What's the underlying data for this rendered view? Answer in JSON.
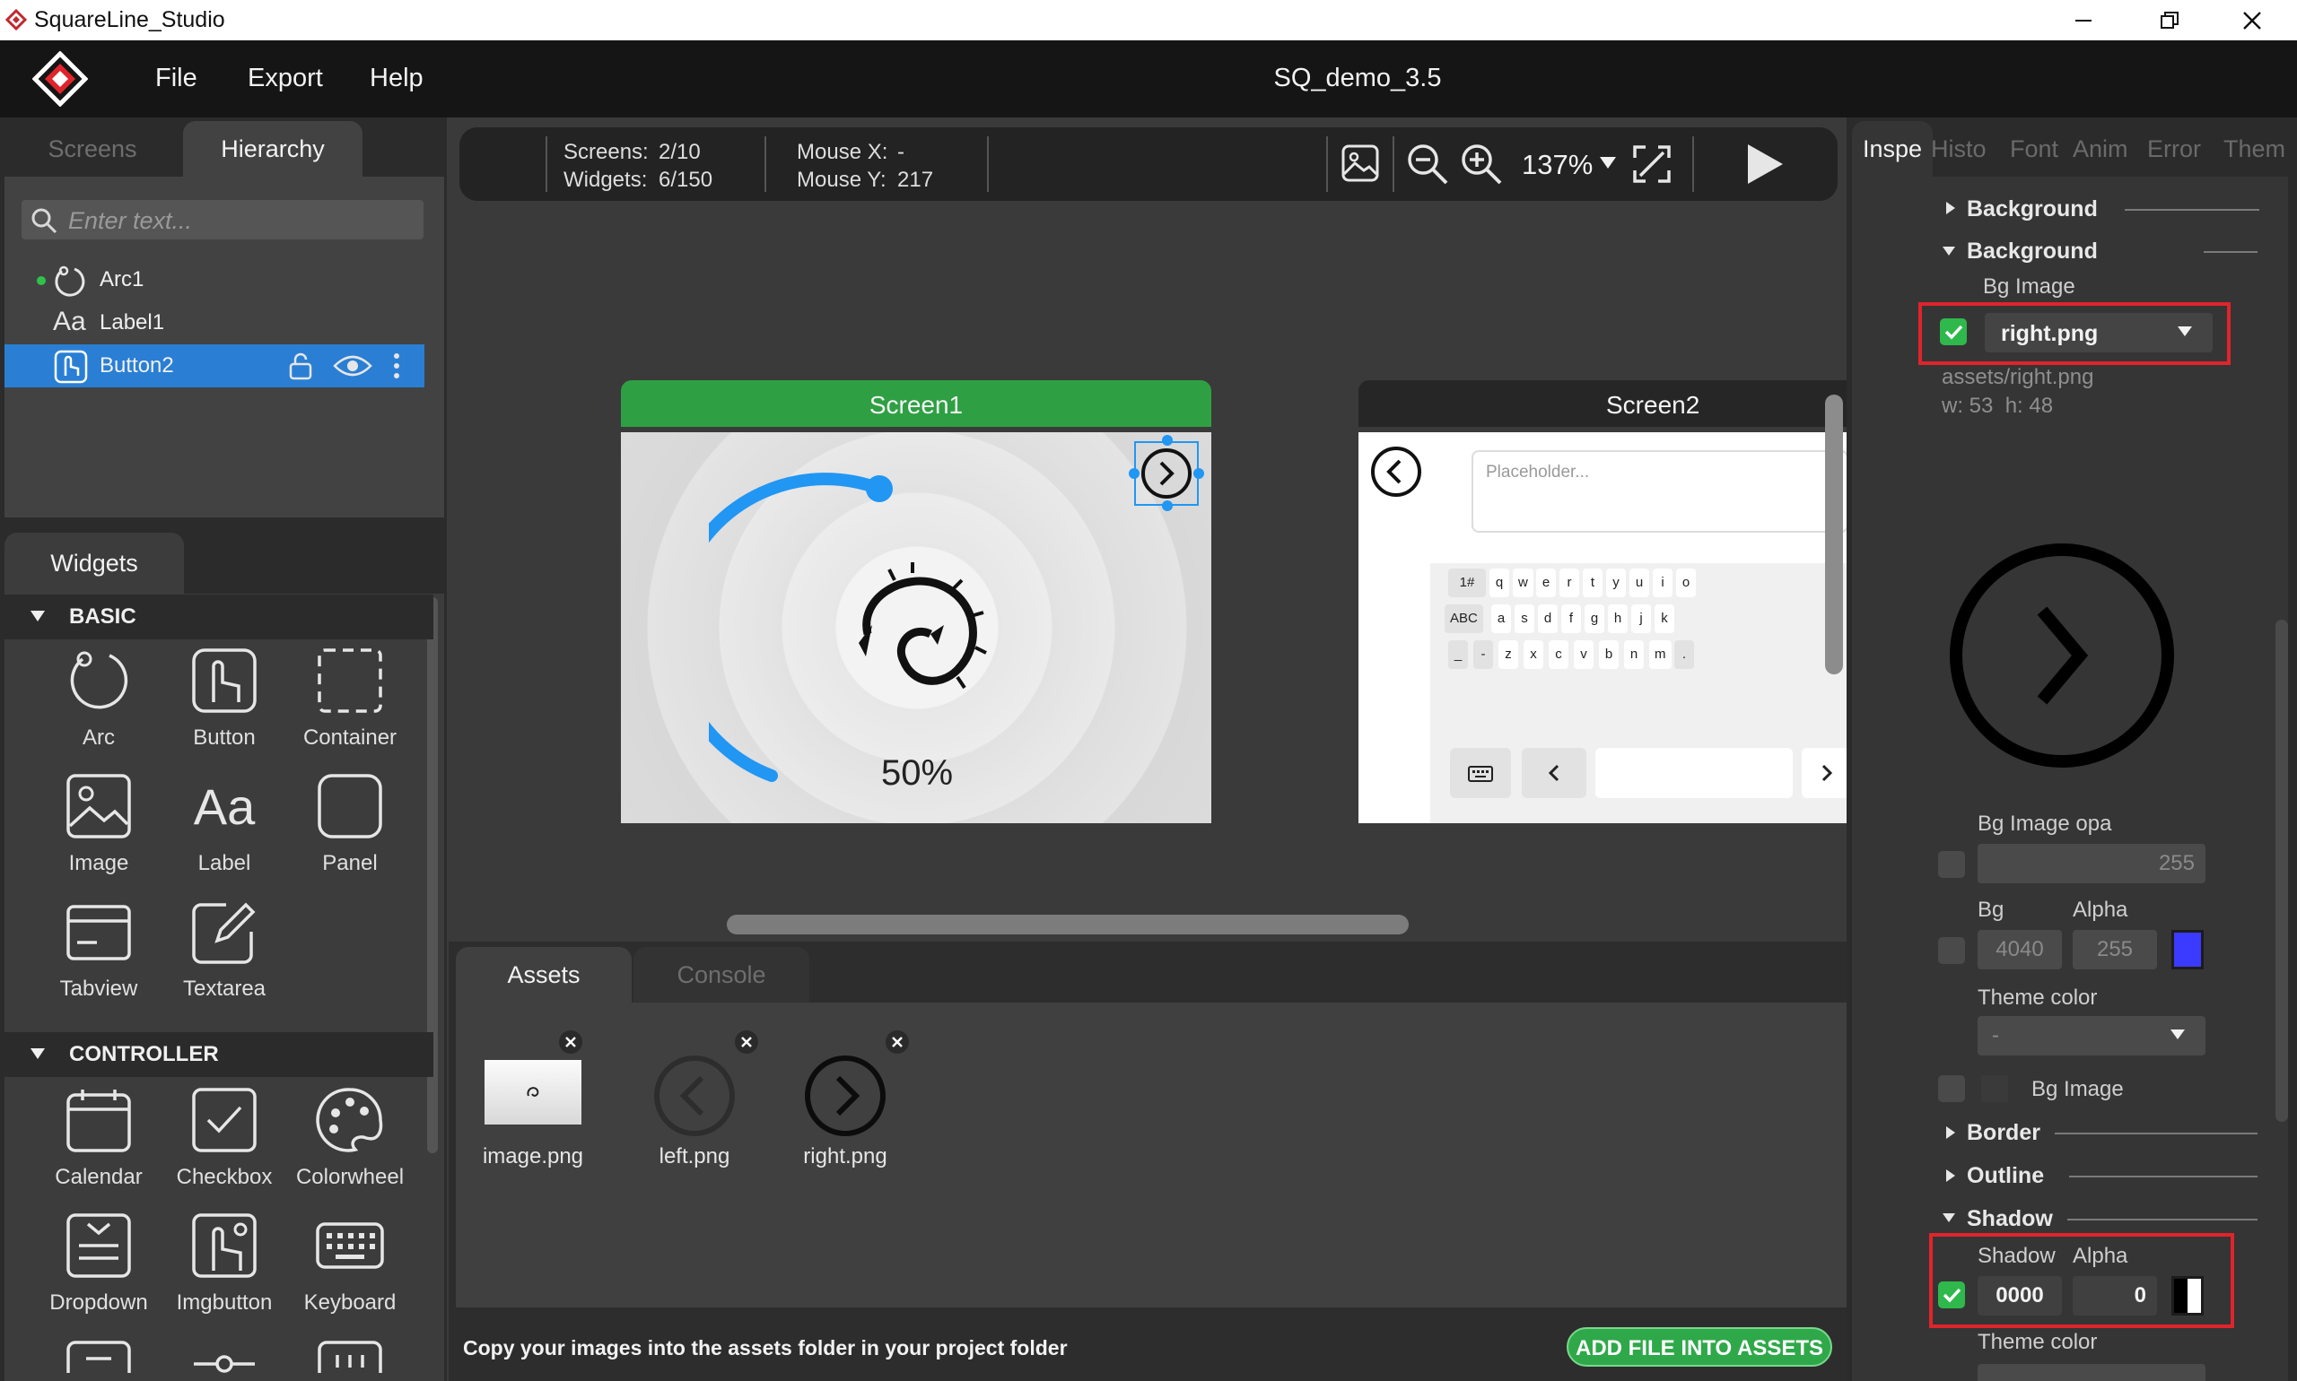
{
  "app": {
    "window_title": "SquareLine_Studio",
    "project_name": "SQ_demo_3.5",
    "menu": [
      "File",
      "Export",
      "Help"
    ]
  },
  "left": {
    "tabs": [
      "Screens",
      "Hierarchy"
    ],
    "search_placeholder": "Enter text...",
    "tree": [
      {
        "label": "Arc1",
        "icon": "arc-icon"
      },
      {
        "label": "Label1",
        "icon": "label-icon"
      },
      {
        "label": "Button2",
        "icon": "button-icon",
        "selected": true
      }
    ],
    "widgets_tab": "Widgets",
    "sections": [
      {
        "title": "BASIC",
        "items": [
          {
            "label": "Arc",
            "icon": "arc-icon"
          },
          {
            "label": "Button",
            "icon": "button-icon"
          },
          {
            "label": "Container",
            "icon": "container-icon"
          },
          {
            "label": "Image",
            "icon": "image-icon"
          },
          {
            "label": "Label",
            "icon": "label-icon"
          },
          {
            "label": "Panel",
            "icon": "panel-icon"
          },
          {
            "label": "Tabview",
            "icon": "tabview-icon"
          },
          {
            "label": "Textarea",
            "icon": "textarea-icon"
          }
        ]
      },
      {
        "title": "CONTROLLER",
        "items": [
          {
            "label": "Calendar",
            "icon": "calendar-icon"
          },
          {
            "label": "Checkbox",
            "icon": "checkbox-icon"
          },
          {
            "label": "Colorwheel",
            "icon": "colorwheel-icon"
          },
          {
            "label": "Dropdown",
            "icon": "dropdown-icon"
          },
          {
            "label": "Imgbutton",
            "icon": "imgbutton-icon"
          },
          {
            "label": "Keyboard",
            "icon": "keyboard-icon"
          }
        ]
      }
    ]
  },
  "toolbar": {
    "screens_label": "Screens:",
    "screens_value": "2/10",
    "widgets_label": "Widgets:",
    "widgets_value": "6/150",
    "mouse_x_label": "Mouse X:",
    "mouse_x_value": "-",
    "mouse_y_label": "Mouse Y:",
    "mouse_y_value": "217",
    "zoom": "137%"
  },
  "canvas": {
    "screen1": {
      "title": "Screen1",
      "arc_value_text": "50%",
      "arc_percent": 50,
      "title_color": "#2ea043"
    },
    "screen2": {
      "title": "Screen2",
      "textarea_placeholder": "Placeholder...",
      "keyboard_rows": [
        [
          "1#",
          "q",
          "w",
          "e",
          "r",
          "t",
          "y",
          "u",
          "i",
          "o"
        ],
        [
          "ABC",
          "a",
          "s",
          "d",
          "f",
          "g",
          "h",
          "j",
          "k"
        ],
        [
          "_",
          "-",
          "z",
          "x",
          "c",
          "v",
          "b",
          "n",
          "m",
          "."
        ]
      ]
    }
  },
  "bottom": {
    "tabs": [
      "Assets",
      "Console"
    ],
    "assets": [
      {
        "name": "image.png"
      },
      {
        "name": "left.png"
      },
      {
        "name": "right.png"
      }
    ],
    "hint": "Copy your images into the assets folder in your project folder",
    "add_button": "ADD FILE INTO ASSETS"
  },
  "inspector": {
    "tabs": [
      "Inspe",
      "Histo",
      "Font",
      "Anim",
      "Error",
      "Them"
    ],
    "background_collapsed": "Background",
    "background_expanded": "Background",
    "bg_image_label": "Bg Image",
    "bg_image_value": "right.png",
    "bg_image_path": "assets/right.png",
    "bg_image_size": "w: 53  h: 48",
    "bg_image_opa_label": "Bg Image opa",
    "bg_image_opa_value": "255",
    "bg_label": "Bg",
    "alpha_label": "Alpha",
    "bg_color_value": "4040",
    "bg_alpha_value": "255",
    "bg_swatch_color": "#3b3bff",
    "theme_color_label": "Theme color",
    "theme_color_value": "-",
    "bg_image_label2": "Bg Image",
    "border": "Border",
    "outline": "Outline",
    "shadow": "Shadow",
    "shadow_label": "Shadow",
    "shadow_alpha_label": "Alpha",
    "shadow_color_value": "0000",
    "shadow_alpha_value": "0",
    "theme_color_label2": "Theme color"
  }
}
